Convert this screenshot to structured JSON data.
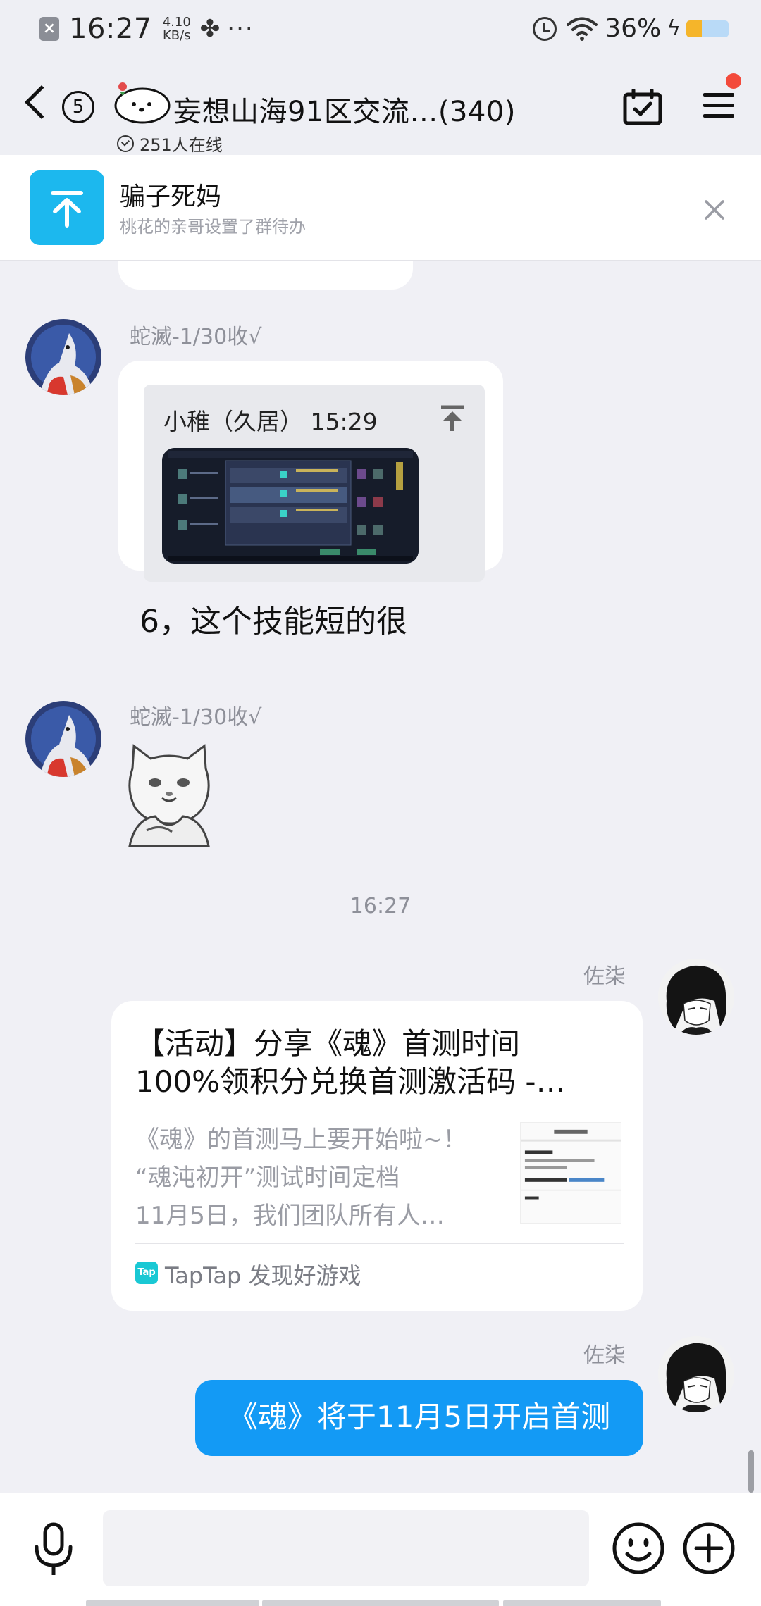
{
  "status_bar": {
    "time": "16:27",
    "speed_value": "4.10",
    "speed_unit": "KB/s",
    "battery_percent": "36%",
    "battery_level": 0.36,
    "icons": [
      "close-notification-icon",
      "fan-icon",
      "more-dots-icon",
      "alarm-icon",
      "wifi-icon",
      "charging-icon",
      "battery-icon"
    ]
  },
  "header": {
    "back_count": "5",
    "group_name": "妄想山海91区交流…(340)",
    "online_count": "251人在线"
  },
  "pinned_notice": {
    "title": "骗子死妈",
    "subtitle": "桃花的亲哥设置了群待办"
  },
  "messages": [
    {
      "sender": "蛇滅-1/30收√",
      "quote": {
        "author": "小稚（久居） 15:29"
      },
      "text": "6，这个技能短的很"
    },
    {
      "sender": "蛇滅-1/30收√",
      "sticker": "cat-sticker"
    },
    {
      "divider_time": "16:27"
    },
    {
      "sender": "佐柒",
      "link": {
        "title_line1": "【活动】分享《魂》首测时间",
        "title_line2": "100%领积分兑换首测激活码 -…",
        "desc_line1": "《魂》的首测马上要开始啦~！",
        "desc_line2": "“魂沌初开”测试时间定档",
        "desc_line3": "11月5日，我们团队所有人…",
        "source": "TapTap 发现好游戏",
        "source_icon_text": "Tap"
      }
    },
    {
      "sender": "佐柒",
      "text": "《魂》将于11月5日开启首测"
    }
  ],
  "input_bar": {
    "placeholder": ""
  },
  "colors": {
    "accent_blue": "#139af5",
    "notice_icon": "#1cb8ee",
    "badge_red": "#f34a3b",
    "background": "#f0f0f5"
  }
}
